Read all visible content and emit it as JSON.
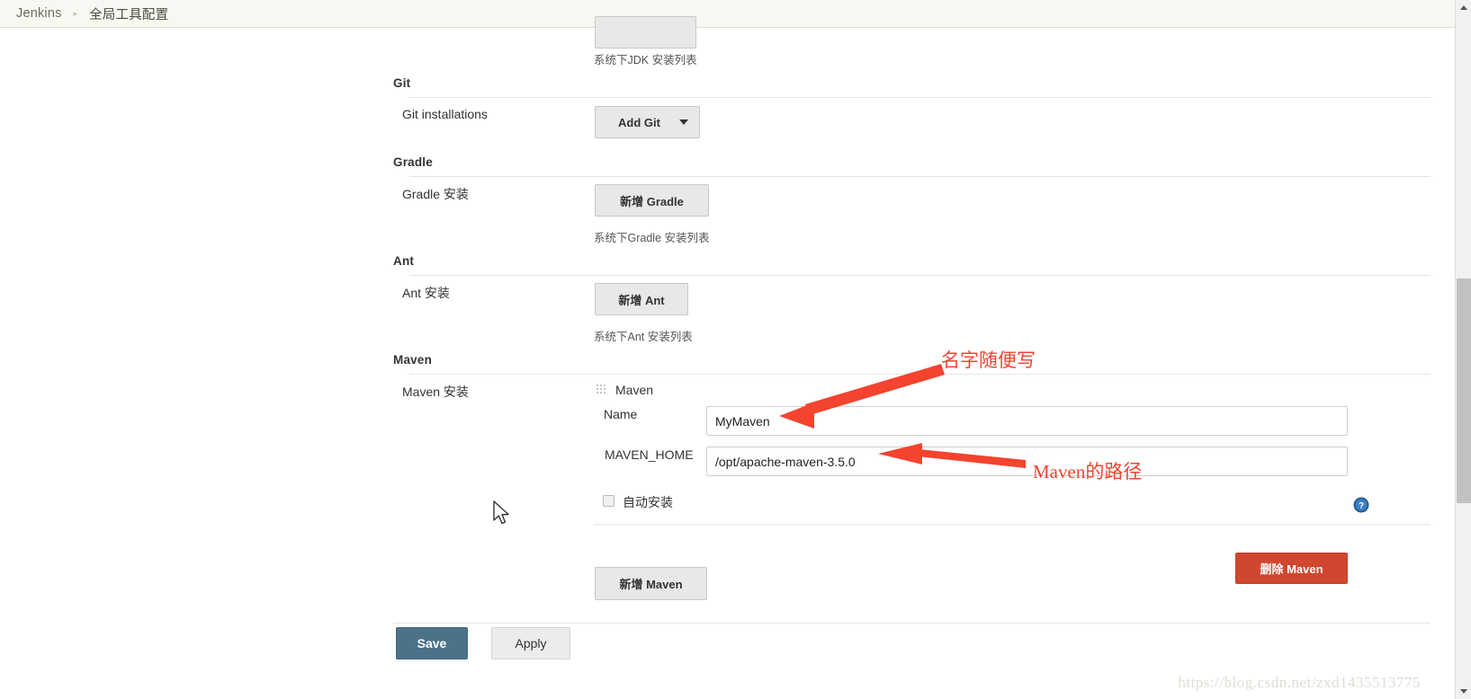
{
  "breadcrumb": {
    "items": [
      {
        "label": "Jenkins"
      },
      {
        "label": "全局工具配置"
      }
    ],
    "separator": "▸"
  },
  "sections": {
    "jdk": {
      "help_text": "系统下JDK 安装列表"
    },
    "git": {
      "title": "Git",
      "row_label": "Git installations",
      "add_button": "Add Git",
      "caret_icon": "chevron-down-icon"
    },
    "gradle": {
      "title": "Gradle",
      "row_label": "Gradle 安装",
      "add_button": "新增 Gradle",
      "help_text": "系统下Gradle 安装列表"
    },
    "ant": {
      "title": "Ant",
      "row_label": "Ant 安装",
      "add_button": "新增 Ant",
      "help_text": "系统下Ant 安装列表"
    },
    "maven": {
      "title": "Maven",
      "row_label": "Maven 安装",
      "group_label": "Maven",
      "name_label": "Name",
      "name_value": "MyMaven",
      "home_label": "MAVEN_HOME",
      "home_value": "/opt/apache-maven-3.5.0",
      "auto_install_label": "自动安装",
      "auto_install_checked": false,
      "delete_button": "删除 Maven",
      "add_button": "新增 Maven",
      "help_icon": "help-icon"
    }
  },
  "footer": {
    "save_label": "Save",
    "apply_label": "Apply"
  },
  "annotations": [
    {
      "text": "名字随便写",
      "color": "#f4432f"
    },
    {
      "text": "Maven的路径",
      "color": "#f4432f"
    }
  ],
  "watermark": "https://blog.csdn.net/zxd1435513775",
  "colors": {
    "accent_save": "#4b7289",
    "danger": "#d1462f",
    "annotation": "#f4432f",
    "breadcrumb_bg": "#f7f8f2"
  }
}
